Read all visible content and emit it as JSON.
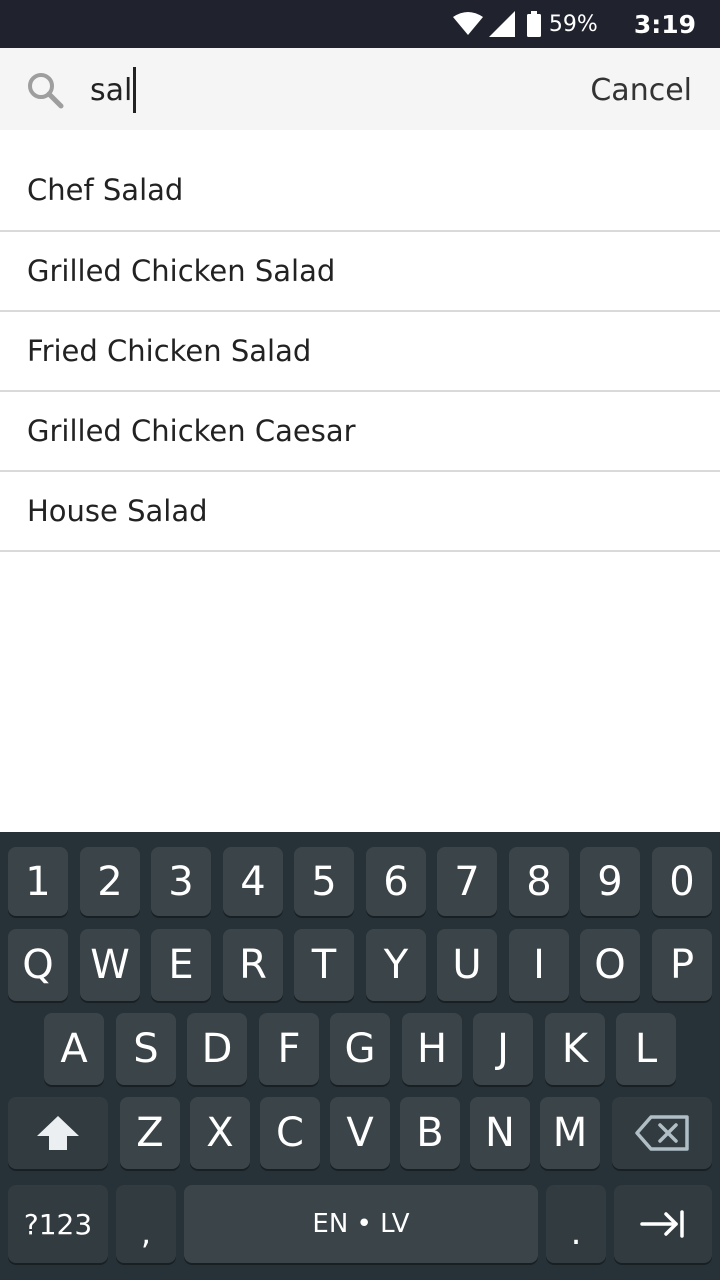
{
  "status_bar": {
    "battery_percent": "59%",
    "time": "3:19"
  },
  "search": {
    "query": "sal",
    "cancel_label": "Cancel"
  },
  "results": [
    "Chef Salad",
    "Grilled Chicken Salad",
    "Fried Chicken Salad",
    "Grilled Chicken Caesar",
    "House Salad"
  ],
  "keyboard": {
    "number_row": [
      "1",
      "2",
      "3",
      "4",
      "5",
      "6",
      "7",
      "8",
      "9",
      "0"
    ],
    "row1": [
      "Q",
      "W",
      "E",
      "R",
      "T",
      "Y",
      "U",
      "I",
      "O",
      "P"
    ],
    "row2": [
      "A",
      "S",
      "D",
      "F",
      "G",
      "H",
      "J",
      "K",
      "L"
    ],
    "row3": [
      "Z",
      "X",
      "C",
      "V",
      "B",
      "N",
      "M"
    ],
    "symbols_label": "?123",
    "comma": ",",
    "space_label": "EN • LV",
    "period": ".",
    "shift_icon": "shift-icon",
    "backspace_icon": "backspace-icon",
    "next_icon": "tab-arrow-icon"
  },
  "colors": {
    "status_bar": "#20222e",
    "search_bar": "#f5f5f5",
    "keyboard_bg": "#263238",
    "key_bg": "#3b4448"
  }
}
